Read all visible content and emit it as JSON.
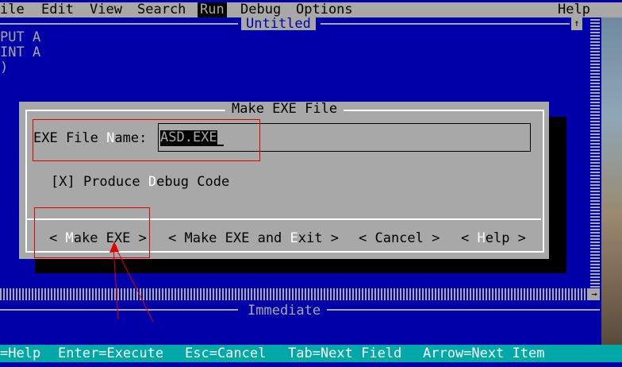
{
  "menubar": {
    "items": [
      {
        "label": "File",
        "shown": "ile"
      },
      {
        "label": "Edit"
      },
      {
        "label": "View"
      },
      {
        "label": "Search"
      },
      {
        "label": "Run"
      },
      {
        "label": "Debug"
      },
      {
        "label": "Options"
      },
      {
        "label": "Help"
      }
    ]
  },
  "editor": {
    "title": "Untitled",
    "code_lines": [
      "PUT A",
      "INT A",
      ")"
    ],
    "scroll_up_glyph": "↑",
    "scroll_right_glyph": "→"
  },
  "immediate": {
    "title": "Immediate"
  },
  "dialog": {
    "title": "Make EXE File",
    "exe_label_a": "EXE File ",
    "exe_label_hot": "N",
    "exe_label_b": "ame:",
    "exe_value": "ASD.EXE",
    "debug_a": "[X] Produce ",
    "debug_hot": "D",
    "debug_b": "ebug Code",
    "buttons": [
      {
        "pre": "< ",
        "hot": "M",
        "post": "ake EXE >"
      },
      {
        "pre": "< Make EXE and ",
        "hot": "E",
        "post": "xit >"
      },
      {
        "pre": "< Cancel >",
        "hot": "",
        "post": ""
      },
      {
        "pre": "< ",
        "hot": "H",
        "post": "elp >"
      }
    ]
  },
  "statusbar": {
    "items": [
      "=Help",
      "Enter=Execute",
      "Esc=Cancel",
      "Tab=Next Field",
      "Arrow=Next Item"
    ]
  },
  "colors": {
    "background": "#0000a8",
    "gray": "#a8a8a8",
    "status": "#00a8a8",
    "annotation": "#e00000"
  }
}
